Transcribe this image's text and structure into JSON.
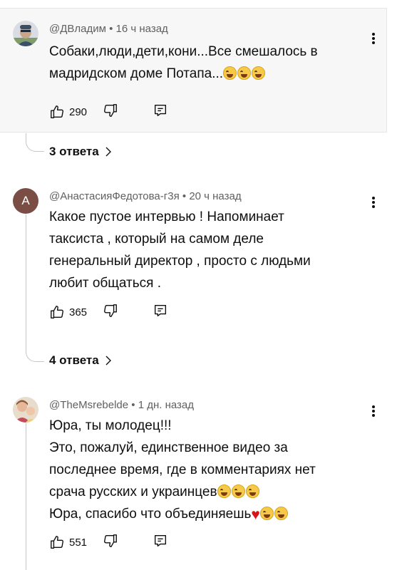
{
  "comments": [
    {
      "author": "@ДВладим",
      "time": "16 ч назад",
      "lines": [
        "Собаки,люди,дети,кони...Все смешалось в",
        "мадридском доме Потапа..."
      ],
      "emoji_count": 3,
      "likes": "290",
      "replies": "3 ответа"
    },
    {
      "author": "@АнастасияФедотова-г3я",
      "avatar_letter": "А",
      "time": "20 ч назад",
      "lines": [
        "Какое пустое интервью ! Напоминает",
        "таксиста , который на самом деле",
        "генеральный директор , просто с людьми",
        "любит общаться ."
      ],
      "likes": "365",
      "replies": "4 ответа"
    },
    {
      "author": "@TheMsrebelde",
      "time": "1 дн. назад",
      "lines": [
        "Юра, ты молодец!!!",
        "Это, пожалуй, единственное видео за",
        "последнее время, где в комментариях нет",
        "срача русских и украинцев",
        "Юра, спасибо что объединяешь"
      ],
      "likes": "551"
    }
  ],
  "separator": "•",
  "icons": {
    "like": "thumbs-up-icon",
    "dislike": "thumbs-down-icon",
    "reply": "reply-icon",
    "menu": "more-vertical-icon",
    "chevron": "chevron-right-icon",
    "emoji": "laughing-tears-emoji",
    "heart": "red-heart-emoji"
  },
  "colors": {
    "text": "#0f0f0f",
    "meta": "#606060",
    "highlight_bg": "#f7f7f7",
    "avatar_letter_bg": "#7a4e45"
  }
}
